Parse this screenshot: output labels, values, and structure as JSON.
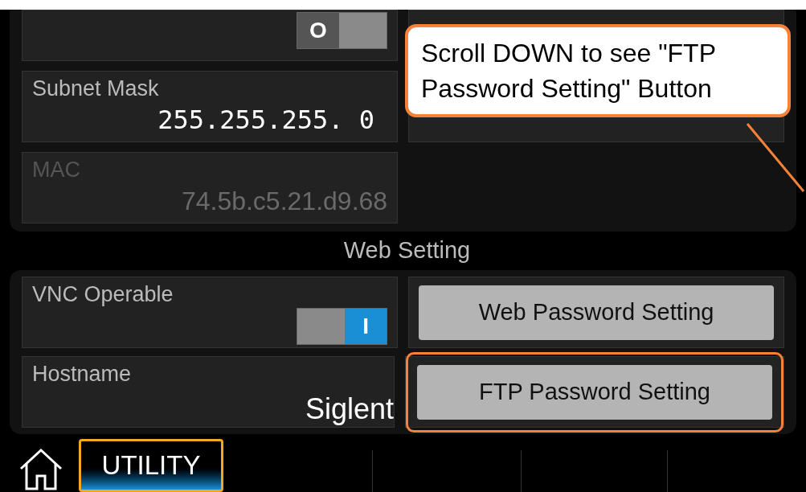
{
  "network": {
    "rows": [
      {
        "cells": [
          {
            "kind": "toggle",
            "on": false,
            "glyph": "O"
          },
          {
            "kind": "blank"
          }
        ]
      },
      {
        "cells": [
          {
            "kind": "value",
            "label": "Subnet Mask",
            "value": "255.255.255. 0",
            "disabled": false
          },
          {
            "kind": "blank"
          }
        ]
      },
      {
        "cells": [
          {
            "kind": "value",
            "label": "MAC",
            "value": "74.5b.c5.21.d9.68",
            "disabled": true
          },
          {
            "kind": "none"
          }
        ]
      }
    ]
  },
  "web": {
    "title": "Web Setting",
    "rows": [
      {
        "cells": [
          {
            "kind": "toggle",
            "label": "VNC Operable",
            "on": true,
            "glyph": "I"
          },
          {
            "kind": "button",
            "label": "Web Password Setting",
            "highlighted": false
          }
        ]
      },
      {
        "cells": [
          {
            "kind": "text",
            "label": "Hostname",
            "value": "Siglent"
          },
          {
            "kind": "button",
            "label": "FTP Password Setting",
            "highlighted": true
          }
        ]
      }
    ]
  },
  "callout": {
    "text": "Scroll DOWN to see \"FTP Password Setting\" Button"
  },
  "bottom_bar": {
    "tabs": [
      {
        "label": "UTILITY",
        "selected": true
      }
    ]
  }
}
